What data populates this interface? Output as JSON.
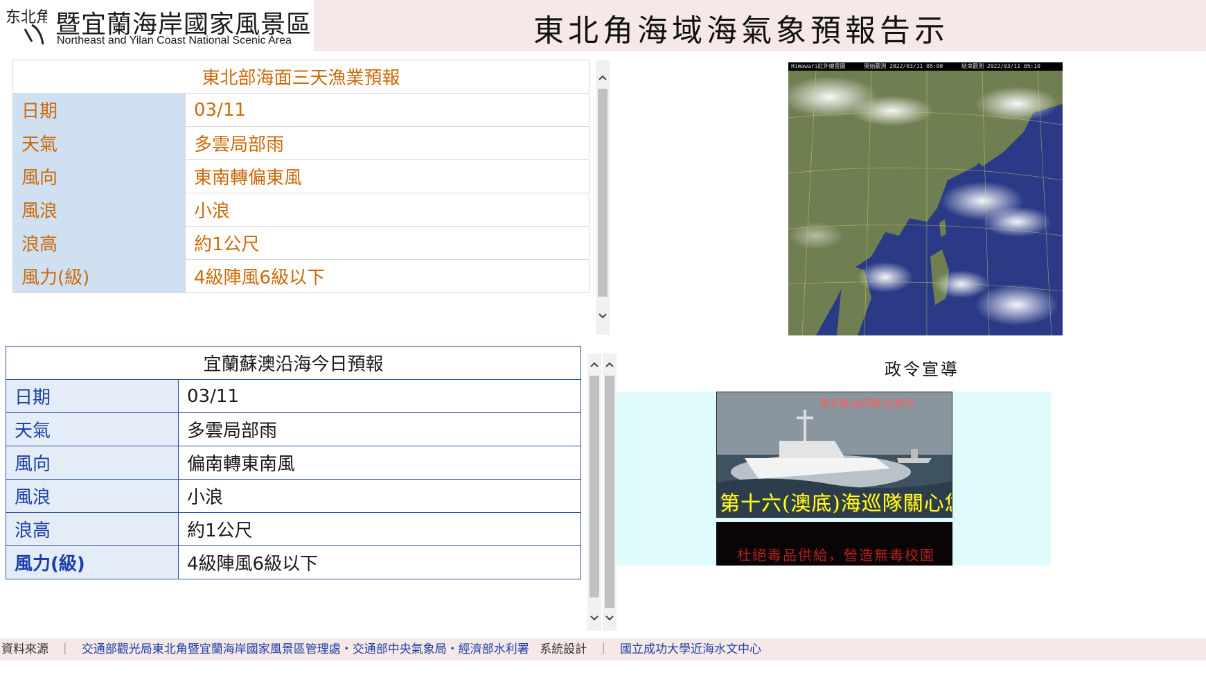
{
  "header": {
    "logo_mark": "东北角",
    "logo_title": "暨宜蘭海岸國家風景區",
    "logo_subtitle": "Northeast and Yilan Coast National Scenic Area",
    "page_title": "東北角海域海氣象預報告示"
  },
  "fishery_forecast": {
    "title": "東北部海面三天漁業預報",
    "rows": [
      {
        "label": "日期",
        "value": "03/11"
      },
      {
        "label": "天氣",
        "value": "多雲局部雨"
      },
      {
        "label": "風向",
        "value": "東南轉偏東風"
      },
      {
        "label": "風浪",
        "value": "小浪"
      },
      {
        "label": "浪高",
        "value": "約1公尺"
      },
      {
        "label": "風力(級)",
        "value": "4級陣風6級以下"
      }
    ]
  },
  "coastal_forecast": {
    "title": "宜蘭蘇澳沿海今日預報",
    "rows": [
      {
        "label": "日期",
        "value": "03/11"
      },
      {
        "label": "天氣",
        "value": "多雲局部雨"
      },
      {
        "label": "風向",
        "value": "偏南轉東南風"
      },
      {
        "label": "風浪",
        "value": "小浪"
      },
      {
        "label": "浪高",
        "value": "約1公尺"
      },
      {
        "label": "風力(級)",
        "value": "4級陣風6級以下"
      }
    ]
  },
  "satellite": {
    "caption_left": "Himawari紅外線雲圖",
    "caption_mid": "開始觀測 2022/03/11 05:00",
    "caption_right": "結束觀測 2022/03/11 05:10"
  },
  "promotion": {
    "title": "政令宣導",
    "image1_top_caption": "用多層(含雨層)洗對抗",
    "image1_caption": "第十六(澳底)海巡隊關心您",
    "image2_caption": "杜絕毒品供給，營造無毒校園"
  },
  "footer": {
    "source_label": "資料來源",
    "sep": "｜",
    "sources": "交通部觀光局東北角暨宜蘭海岸國家風景區管理處・交通部中央氣象局・經濟部水利署",
    "design_label": "系統設計",
    "designer": "國立成功大學近海水文中心"
  },
  "colors": {
    "header_bg": "#f7e8e8",
    "orange_text": "#cc6a0a",
    "blue_label": "#1a3fa8",
    "label_bg": "#cfe0f2",
    "promo_bg": "#e0fbfb"
  },
  "icons": {
    "scroll_up": "chevron-up-icon",
    "scroll_down": "chevron-down-icon"
  }
}
